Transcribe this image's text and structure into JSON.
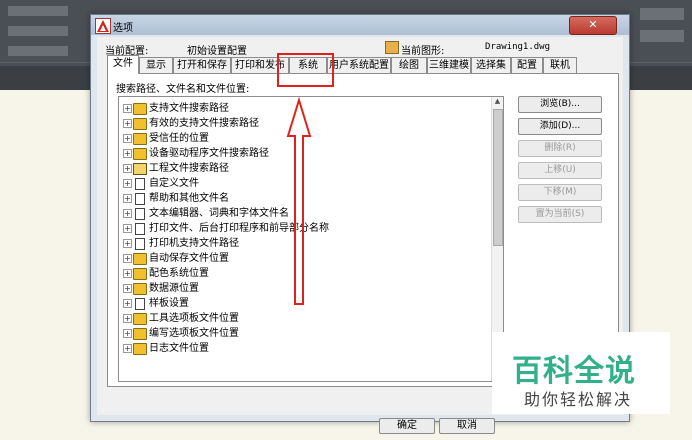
{
  "dialog": {
    "title": "选项",
    "close": "✕",
    "current_config_label": "当前配置:",
    "current_config_value": "初始设置配置",
    "current_drawing_label": "当前图形:",
    "current_drawing_value": "Drawing1.dwg"
  },
  "tabs": [
    "文件",
    "显示",
    "打开和保存",
    "打印和发布",
    "系统",
    "用户系统配置",
    "绘图",
    "三维建模",
    "选择集",
    "配置",
    "联机"
  ],
  "panel": {
    "search_label": "搜索路径、文件名和文件位置:"
  },
  "tree_items": [
    {
      "label": "支持文件搜索路径",
      "icon": "folder"
    },
    {
      "label": "有效的支持文件搜索路径",
      "icon": "folder"
    },
    {
      "label": "受信任的位置",
      "icon": "folder"
    },
    {
      "label": "设备驱动程序文件搜索路径",
      "icon": "folder"
    },
    {
      "label": "工程文件搜索路径",
      "icon": "project"
    },
    {
      "label": "自定义文件",
      "icon": "doc"
    },
    {
      "label": "帮助和其他文件名",
      "icon": "doc"
    },
    {
      "label": "文本编辑器、词典和字体文件名",
      "icon": "doc"
    },
    {
      "label": "打印文件、后台打印程序和前导部分名称",
      "icon": "doc"
    },
    {
      "label": "打印机支持文件路径",
      "icon": "doc"
    },
    {
      "label": "自动保存文件位置",
      "icon": "folder"
    },
    {
      "label": "配色系统位置",
      "icon": "folder"
    },
    {
      "label": "数据源位置",
      "icon": "folder"
    },
    {
      "label": "样板设置",
      "icon": "doc"
    },
    {
      "label": "工具选项板文件位置",
      "icon": "folder"
    },
    {
      "label": "编写选项板文件位置",
      "icon": "folder"
    },
    {
      "label": "日志文件位置",
      "icon": "folder"
    }
  ],
  "side_buttons": [
    {
      "label": "浏览(B)...",
      "enabled": true
    },
    {
      "label": "添加(D)...",
      "enabled": true
    },
    {
      "label": "删除(R)",
      "enabled": false
    },
    {
      "label": "上移(U)",
      "enabled": false
    },
    {
      "label": "下移(M)",
      "enabled": false
    },
    {
      "label": "置为当前(S)",
      "enabled": false
    }
  ],
  "bottom_buttons": {
    "ok": "确定",
    "cancel": "取消"
  },
  "watermark": {
    "big": "百科全说",
    "small": "助你轻松解决"
  },
  "colors": {
    "annotation": "#e0221f",
    "watermark": "#31b08a",
    "ribbon": "#4a4f55"
  }
}
